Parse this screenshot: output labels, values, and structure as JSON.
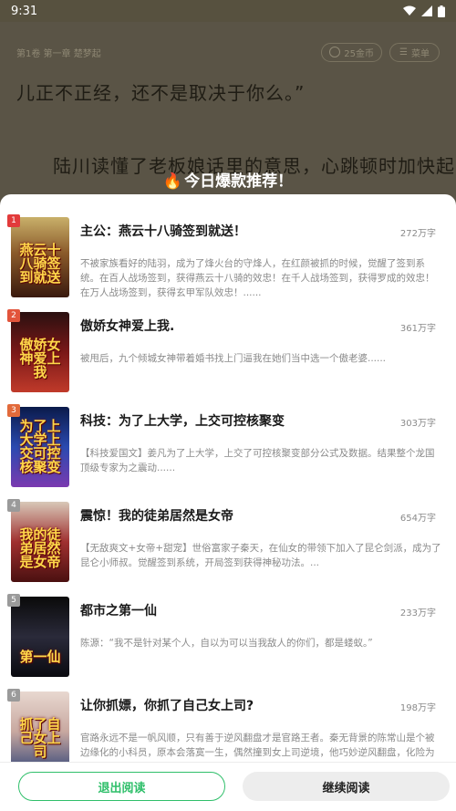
{
  "status": {
    "time": "9:31"
  },
  "reader": {
    "chapter": "第1卷 第一章 楚梦起",
    "coins": "25金币",
    "menu": "菜单",
    "line1": "儿正不正经，还不是取决于你么。”",
    "line2": "陆川读懂了老板娘话里的意思，心跳顿时加快起"
  },
  "popup": {
    "title": "今日爆款推荐！"
  },
  "books": [
    {
      "rank": "1",
      "rank_color": "#e23b3b",
      "title": "主公：燕云十八骑签到就送！",
      "words": "272万字",
      "desc": "不被家族看好的陆羽，成为了烽火台的守烽人，在红颜被抓的时候，觉醒了签到系统。在百人战场签到，获得燕云十八骑的效忠！在千人战场签到，获得罗成的效忠！在万人战场签到，获得玄甲军队效忠！......",
      "cover_text": "燕云十八骑签到就送",
      "cover_bg": "linear-gradient(180deg,#c9b06a 0%,#8a5a2a 45%,#3a1a0e 100%)"
    },
    {
      "rank": "2",
      "rank_color": "#e2543b",
      "title": "傲娇女神爱上我.",
      "words": "361万字",
      "desc": "被甩后，九个倾城女神带着婚书找上门逼我在她们当中选一个傲老婆......",
      "cover_text": "傲娇女神爱上我",
      "cover_bg": "linear-gradient(180deg,#2a1010 0%,#7a1818 50%,#c03a2a 100%)"
    },
    {
      "rank": "3",
      "rank_color": "#e26a3b",
      "title": "科技：为了上大学，上交可控核聚变",
      "words": "303万字",
      "desc": "【科技爱国文】姜凡为了上大学，上交了可控核聚变部分公式及数据。结果整个龙国顶级专家为之震动......",
      "cover_text": "为了上大学上交可控核聚变",
      "cover_bg": "linear-gradient(180deg,#0a1a4a 0%,#2a4ab0 50%,#7a3ab0 100%)"
    },
    {
      "rank": "4",
      "rank_color": "#9a9a9a",
      "title": "震惊！我的徒弟居然是女帝",
      "words": "654万字",
      "desc": "【无敌爽文+女帝+甜宠】世俗富家子秦天，在仙女的带领下加入了昆仑剑派，成为了昆仑小师叔。觉醒签到系统，开局签到获得神秘功法。...",
      "cover_text": "我的徒弟居然是女帝",
      "cover_bg": "linear-gradient(180deg,#d8c8b8 0%,#a03030 50%,#4a1010 100%)"
    },
    {
      "rank": "5",
      "rank_color": "#9a9a9a",
      "title": "都市之第一仙",
      "words": "233万字",
      "desc": "陈源：“我不是针对某个人，自以为可以当我敌人的你们，都是蝼蚁。”",
      "cover_text": "第一仙",
      "cover_bg": "linear-gradient(180deg,#0a0a0a 0%,#2a2a3a 50%,#0a0a10 100%)"
    },
    {
      "rank": "6",
      "rank_color": "#9a9a9a",
      "title": "让你抓嫖，你抓了自己女上司?",
      "words": "198万字",
      "desc": "官路永远不是一帆风顺，只有善于逆风翻盘才是官路王者。秦无背景的陈常山是个被边缘化的小科员，原本会落寞一生，偶然撞到女上司逆境，他巧妙逆风翻盘，化险为夷，改变逆境，由此踏上升迁路。继续上演",
      "cover_text": "抓了自己女上司",
      "cover_bg": "linear-gradient(180deg,#e8d8d0 0%,#c8a8a0 50%,#3a4a7a 100%)"
    }
  ],
  "buttons": {
    "exit": "退出阅读",
    "continue": "继续阅读"
  }
}
